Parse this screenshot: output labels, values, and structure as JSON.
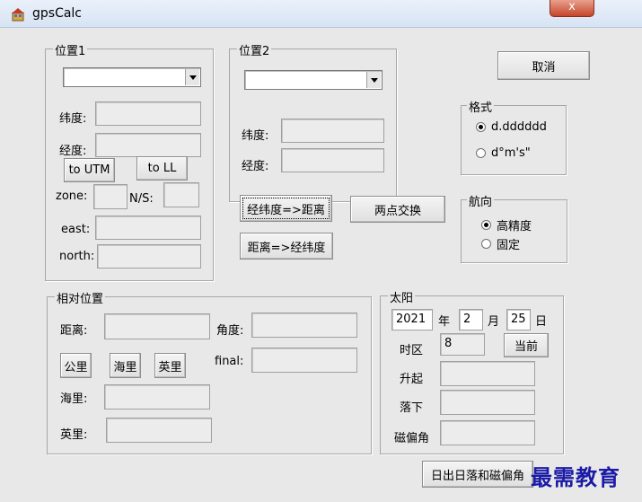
{
  "window": {
    "title": "gpsCalc",
    "close_symbol": "x"
  },
  "pos1": {
    "legend": "位置1",
    "lat_label": "纬度:",
    "lon_label": "经度:",
    "to_utm": "to UTM",
    "to_ll": "to LL",
    "zone_label": "zone:",
    "ns_label": "N/S:",
    "east_label": "east:",
    "north_label": "north:"
  },
  "pos2": {
    "legend": "位置2",
    "lat_label": "纬度:",
    "lon_label": "经度:"
  },
  "buttons": {
    "cancel": "取消",
    "ll_to_dist": "经纬度=>距离",
    "dist_to_ll": "距离=>经纬度",
    "swap": "两点交换"
  },
  "format": {
    "legend": "格式",
    "options": [
      "d.dddddd",
      "d°m's\""
    ],
    "selected": 0
  },
  "course": {
    "legend": "航向",
    "options": [
      "高精度",
      "固定"
    ],
    "selected": 0
  },
  "relative": {
    "legend": "相对位置",
    "dist_label": "距离:",
    "angle_label": "角度:",
    "km": "公里",
    "nmi": "海里",
    "mile": "英里",
    "final_label": "final:",
    "nmi_label": "海里:",
    "mile_label": "英里:"
  },
  "sun": {
    "legend": "太阳",
    "year": "2021",
    "year_unit": "年",
    "month": "2",
    "month_unit": "月",
    "day": "25",
    "day_unit": "日",
    "tz_label": "时区",
    "tz_value": "8",
    "now_button": "当前",
    "rise_label": "升起",
    "set_label": "落下",
    "mag_label": "磁偏角"
  },
  "bottom_button": "日出日落和磁偏角",
  "watermark": "最需教育"
}
